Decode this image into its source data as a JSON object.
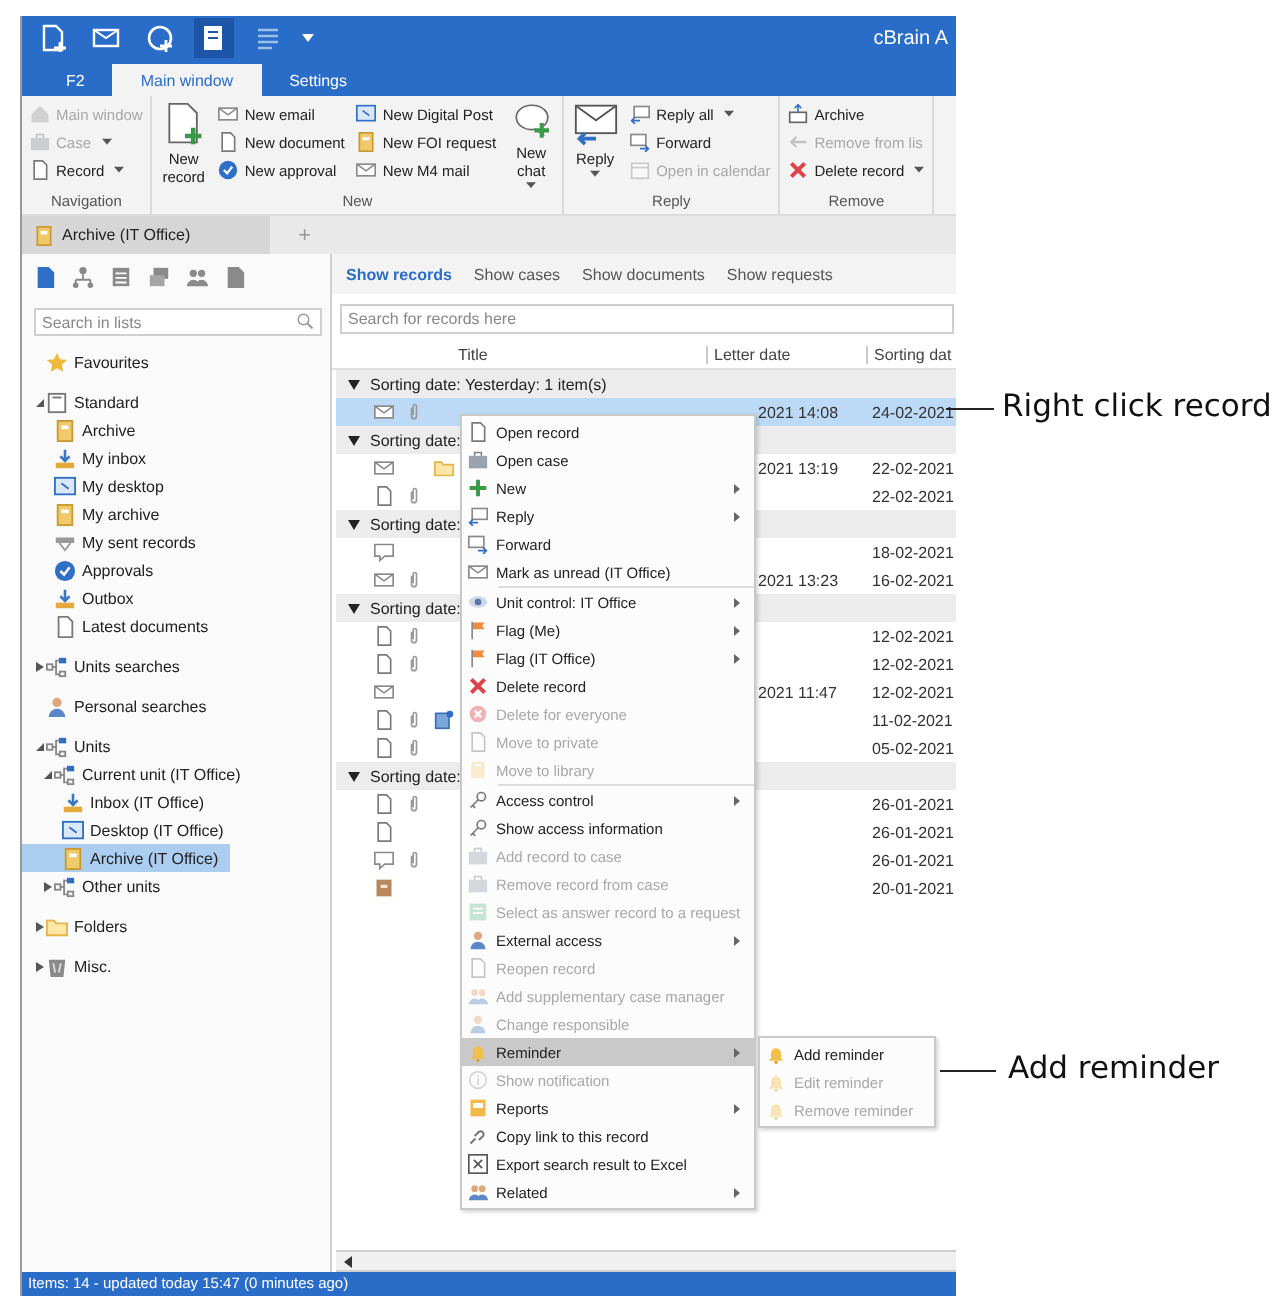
{
  "window": {
    "title": "cBrain A"
  },
  "ribbon": {
    "tabs": [
      {
        "label": "F2",
        "selected": false
      },
      {
        "label": "Main window",
        "selected": true
      },
      {
        "label": "Settings",
        "selected": false
      }
    ],
    "groups": [
      {
        "label": "Navigation",
        "columns": [
          {
            "kind": "stack",
            "items": [
              {
                "label": "Main window",
                "disabled": true,
                "dropdown": false
              },
              {
                "label": "Case",
                "disabled": true,
                "dropdown": true
              },
              {
                "label": "Record",
                "disabled": false,
                "dropdown": true
              }
            ]
          }
        ]
      },
      {
        "label": "New",
        "columns": [
          {
            "kind": "large",
            "label": "New record",
            "dropdown": false
          },
          {
            "kind": "stack",
            "items": [
              {
                "label": "New email",
                "disabled": false,
                "dropdown": false
              },
              {
                "label": "New document",
                "disabled": false,
                "dropdown": false
              },
              {
                "label": "New approval",
                "disabled": false,
                "dropdown": false
              }
            ]
          },
          {
            "kind": "stack",
            "items": [
              {
                "label": "New Digital Post",
                "disabled": false,
                "dropdown": false
              },
              {
                "label": "New FOI request",
                "disabled": false,
                "dropdown": false
              },
              {
                "label": "New M4 mail",
                "disabled": false,
                "dropdown": false
              }
            ]
          },
          {
            "kind": "large",
            "label": "New chat",
            "dropdown": true
          }
        ]
      },
      {
        "label": "Reply",
        "columns": [
          {
            "kind": "large",
            "label": "Reply",
            "dropdown": true
          },
          {
            "kind": "stack",
            "items": [
              {
                "label": "Reply all",
                "disabled": false,
                "dropdown": true
              },
              {
                "label": "Forward",
                "disabled": false,
                "dropdown": false
              },
              {
                "label": "Open in calendar",
                "disabled": true,
                "dropdown": false
              }
            ]
          }
        ]
      },
      {
        "label": "Remove",
        "columns": [
          {
            "kind": "stack",
            "items": [
              {
                "label": "Archive",
                "disabled": false,
                "dropdown": false
              },
              {
                "label": "Remove from lis",
                "disabled": true,
                "dropdown": false
              },
              {
                "label": "Delete record",
                "disabled": false,
                "dropdown": true
              }
            ]
          }
        ]
      }
    ]
  },
  "document_tabs": [
    {
      "label": "Archive (IT Office)",
      "selected": true
    }
  ],
  "new_tab": "+",
  "sidebar": {
    "search": {
      "placeholder": "Search in lists"
    },
    "tree": [
      {
        "label": "Favourites",
        "selected": false
      },
      {
        "label": "Standard",
        "expanded": true,
        "selected": false,
        "children": [
          {
            "label": "Archive",
            "selected": false
          },
          {
            "label": "My inbox",
            "selected": false
          },
          {
            "label": "My desktop",
            "selected": false
          },
          {
            "label": "My archive",
            "selected": false
          },
          {
            "label": "My sent records",
            "selected": false
          },
          {
            "label": "Approvals",
            "selected": false
          },
          {
            "label": "Outbox",
            "selected": false
          },
          {
            "label": "Latest documents",
            "selected": false
          }
        ]
      },
      {
        "label": "Units searches",
        "expanded": false,
        "selected": false
      },
      {
        "label": "Personal searches",
        "selected": false
      },
      {
        "label": "Units",
        "expanded": true,
        "selected": false,
        "children": [
          {
            "label": "Current unit (IT Office)",
            "expanded": true,
            "selected": false,
            "children": [
              {
                "label": "Inbox (IT Office)",
                "selected": false
              },
              {
                "label": "Desktop (IT Office)",
                "selected": false
              },
              {
                "label": "Archive (IT Office)",
                "selected": true
              }
            ]
          },
          {
            "label": "Other units",
            "expanded": false,
            "selected": false
          }
        ]
      },
      {
        "label": "Folders",
        "expanded": false,
        "selected": false
      },
      {
        "label": "Misc.",
        "expanded": false,
        "selected": false
      }
    ]
  },
  "views": [
    {
      "label": "Show records",
      "selected": true
    },
    {
      "label": "Show cases",
      "selected": false
    },
    {
      "label": "Show documents",
      "selected": false
    },
    {
      "label": "Show requests",
      "selected": false
    }
  ],
  "records": {
    "search": {
      "placeholder": "Search for records here"
    },
    "columns": [
      "Title",
      "Letter date",
      "Sorting dat"
    ],
    "groups": [
      {
        "header": "Sorting date: Yesterday: 1 item(s)",
        "expanded": true,
        "rows": [
          {
            "kind": "mail",
            "attachment": true,
            "selected": true,
            "letter_date": "2021 14:08",
            "sorting_date": "24-02-2021"
          }
        ]
      },
      {
        "header": "Sorting date:",
        "expanded": true,
        "rows": [
          {
            "kind": "mail",
            "attachment": false,
            "folder": true,
            "selected": false,
            "letter_date": "2021 13:19",
            "sorting_date": "22-02-2021"
          },
          {
            "kind": "document",
            "attachment": true,
            "selected": false,
            "sorting_date": "22-02-2021"
          }
        ]
      },
      {
        "header": "Sorting date:",
        "expanded": true,
        "rows": [
          {
            "kind": "chat",
            "attachment": false,
            "selected": false,
            "sorting_date": "18-02-2021"
          },
          {
            "kind": "mail",
            "attachment": true,
            "selected": false,
            "letter_date": "2021 13:23",
            "sorting_date": "16-02-2021"
          }
        ]
      },
      {
        "header": "Sorting date:",
        "expanded": true,
        "rows": [
          {
            "kind": "document",
            "attachment": true,
            "selected": false,
            "sorting_date": "12-02-2021"
          },
          {
            "kind": "document",
            "attachment": true,
            "selected": false,
            "sorting_date": "12-02-2021"
          },
          {
            "kind": "mail",
            "attachment": false,
            "selected": false,
            "letter_date": "2021 11:47",
            "sorting_date": "12-02-2021"
          },
          {
            "kind": "document",
            "attachment": true,
            "note": true,
            "selected": false,
            "sorting_date": "11-02-2021"
          },
          {
            "kind": "document",
            "attachment": true,
            "selected": false,
            "sorting_date": "05-02-2021"
          }
        ]
      },
      {
        "header": "Sorting date:",
        "expanded": true,
        "rows": [
          {
            "kind": "document",
            "attachment": true,
            "selected": false,
            "sorting_date": "26-01-2021"
          },
          {
            "kind": "document",
            "attachment": false,
            "selected": false,
            "sorting_date": "26-01-2021"
          },
          {
            "kind": "chat",
            "attachment": true,
            "selected": false,
            "sorting_date": "26-01-2021"
          },
          {
            "kind": "box",
            "attachment": false,
            "selected": false,
            "sorting_date": "20-01-2021"
          }
        ]
      }
    ]
  },
  "context_menu": {
    "items": [
      {
        "label": "Open record",
        "disabled": false,
        "submenu": false,
        "selected": false
      },
      {
        "label": "Open case",
        "disabled": false,
        "submenu": false,
        "selected": false
      },
      {
        "label": "New",
        "disabled": false,
        "submenu": true,
        "selected": false
      },
      {
        "label": "Reply",
        "disabled": false,
        "submenu": true,
        "selected": false
      },
      {
        "label": "Forward",
        "disabled": false,
        "submenu": false,
        "selected": false
      },
      {
        "label": "Mark as unread (IT Office)",
        "disabled": false,
        "submenu": false,
        "selected": false
      },
      {
        "label": "Unit control: IT Office",
        "disabled": false,
        "submenu": true,
        "selected": false,
        "separator_before": true
      },
      {
        "label": "Flag (Me)",
        "disabled": false,
        "submenu": true,
        "selected": false
      },
      {
        "label": "Flag (IT Office)",
        "disabled": false,
        "submenu": true,
        "selected": false
      },
      {
        "label": "Delete record",
        "disabled": false,
        "submenu": false,
        "selected": false
      },
      {
        "label": "Delete for everyone",
        "disabled": true,
        "submenu": false,
        "selected": false
      },
      {
        "label": "Move to private",
        "disabled": true,
        "submenu": false,
        "selected": false
      },
      {
        "label": "Move to library",
        "disabled": true,
        "submenu": false,
        "selected": false
      },
      {
        "label": "Access control",
        "disabled": false,
        "submenu": true,
        "selected": false,
        "separator_before": true
      },
      {
        "label": "Show access information",
        "disabled": false,
        "submenu": false,
        "selected": false
      },
      {
        "label": "Add record to case",
        "disabled": true,
        "submenu": false,
        "selected": false
      },
      {
        "label": "Remove record from case",
        "disabled": true,
        "submenu": false,
        "selected": false
      },
      {
        "label": "Select as answer record to a request",
        "disabled": true,
        "submenu": false,
        "selected": false
      },
      {
        "label": "External access",
        "disabled": false,
        "submenu": true,
        "selected": false
      },
      {
        "label": "Reopen record",
        "disabled": true,
        "submenu": false,
        "selected": false
      },
      {
        "label": "Add supplementary case manager",
        "disabled": true,
        "submenu": false,
        "selected": false
      },
      {
        "label": "Change responsible",
        "disabled": true,
        "submenu": false,
        "selected": false
      },
      {
        "label": "Reminder",
        "disabled": false,
        "submenu": true,
        "selected": true
      },
      {
        "label": "Show notification",
        "disabled": true,
        "submenu": false,
        "selected": false
      },
      {
        "label": "Reports",
        "disabled": false,
        "submenu": true,
        "selected": false
      },
      {
        "label": "Copy link to this record",
        "disabled": false,
        "submenu": false,
        "selected": false
      },
      {
        "label": "Export search result to Excel",
        "disabled": false,
        "submenu": false,
        "selected": false
      },
      {
        "label": "Related",
        "disabled": false,
        "submenu": true,
        "selected": false
      }
    ]
  },
  "submenu": {
    "items": [
      {
        "label": "Add reminder",
        "disabled": false
      },
      {
        "label": "Edit reminder",
        "disabled": true
      },
      {
        "label": "Remove reminder",
        "disabled": true
      }
    ]
  },
  "status_bar": "Items: 14 - updated today 15:47 (0 minutes ago)",
  "callouts": [
    {
      "text": "Right click record"
    },
    {
      "text": "Add reminder"
    }
  ]
}
